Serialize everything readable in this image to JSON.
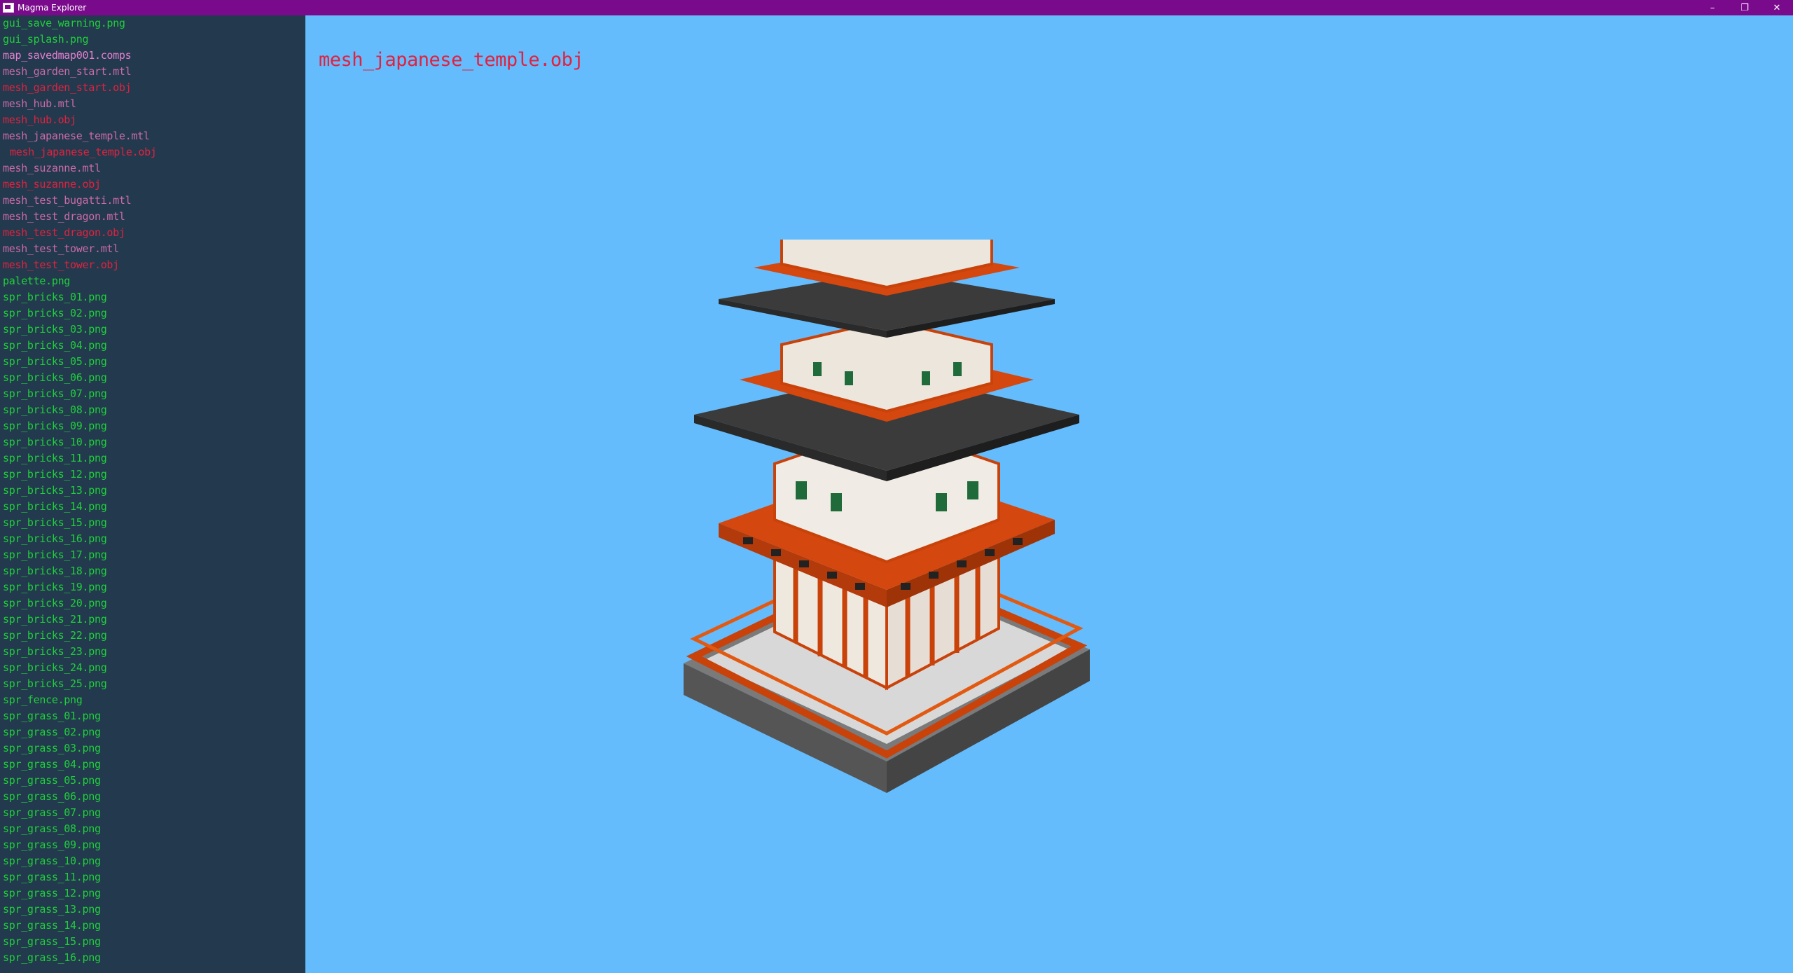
{
  "window": {
    "title": "Magma Explorer",
    "controls": {
      "minimize": "–",
      "maximize": "❐",
      "close": "✕"
    }
  },
  "colors": {
    "title_bar": "#7a0a8c",
    "sidebar_bg": "#233a4e",
    "viewer_bg": "#64bcfd",
    "file_png": "#1fcf3a",
    "file_mtl": "#cc6aa8",
    "file_obj": "#e2213f",
    "file_other": "#e77fd0"
  },
  "files": [
    {
      "name": "gui_save_warning.png",
      "kind": "png"
    },
    {
      "name": "gui_splash.png",
      "kind": "png"
    },
    {
      "name": "map_savedmap001.comps",
      "kind": "other"
    },
    {
      "name": "mesh_garden_start.mtl",
      "kind": "mtl"
    },
    {
      "name": "mesh_garden_start.obj",
      "kind": "obj"
    },
    {
      "name": "mesh_hub.mtl",
      "kind": "mtl"
    },
    {
      "name": "mesh_hub.obj",
      "kind": "obj"
    },
    {
      "name": "mesh_japanese_temple.mtl",
      "kind": "mtl"
    },
    {
      "name": "mesh_japanese_temple.obj",
      "kind": "obj",
      "selected": true
    },
    {
      "name": "mesh_suzanne.mtl",
      "kind": "mtl"
    },
    {
      "name": "mesh_suzanne.obj",
      "kind": "obj"
    },
    {
      "name": "mesh_test_bugatti.mtl",
      "kind": "mtl"
    },
    {
      "name": "mesh_test_dragon.mtl",
      "kind": "mtl"
    },
    {
      "name": "mesh_test_dragon.obj",
      "kind": "obj"
    },
    {
      "name": "mesh_test_tower.mtl",
      "kind": "mtl"
    },
    {
      "name": "mesh_test_tower.obj",
      "kind": "obj"
    },
    {
      "name": "palette.png",
      "kind": "png"
    },
    {
      "name": "spr_bricks_01.png",
      "kind": "png"
    },
    {
      "name": "spr_bricks_02.png",
      "kind": "png"
    },
    {
      "name": "spr_bricks_03.png",
      "kind": "png"
    },
    {
      "name": "spr_bricks_04.png",
      "kind": "png"
    },
    {
      "name": "spr_bricks_05.png",
      "kind": "png"
    },
    {
      "name": "spr_bricks_06.png",
      "kind": "png"
    },
    {
      "name": "spr_bricks_07.png",
      "kind": "png"
    },
    {
      "name": "spr_bricks_08.png",
      "kind": "png"
    },
    {
      "name": "spr_bricks_09.png",
      "kind": "png"
    },
    {
      "name": "spr_bricks_10.png",
      "kind": "png"
    },
    {
      "name": "spr_bricks_11.png",
      "kind": "png"
    },
    {
      "name": "spr_bricks_12.png",
      "kind": "png"
    },
    {
      "name": "spr_bricks_13.png",
      "kind": "png"
    },
    {
      "name": "spr_bricks_14.png",
      "kind": "png"
    },
    {
      "name": "spr_bricks_15.png",
      "kind": "png"
    },
    {
      "name": "spr_bricks_16.png",
      "kind": "png"
    },
    {
      "name": "spr_bricks_17.png",
      "kind": "png"
    },
    {
      "name": "spr_bricks_18.png",
      "kind": "png"
    },
    {
      "name": "spr_bricks_19.png",
      "kind": "png"
    },
    {
      "name": "spr_bricks_20.png",
      "kind": "png"
    },
    {
      "name": "spr_bricks_21.png",
      "kind": "png"
    },
    {
      "name": "spr_bricks_22.png",
      "kind": "png"
    },
    {
      "name": "spr_bricks_23.png",
      "kind": "png"
    },
    {
      "name": "spr_bricks_24.png",
      "kind": "png"
    },
    {
      "name": "spr_bricks_25.png",
      "kind": "png"
    },
    {
      "name": "spr_fence.png",
      "kind": "png"
    },
    {
      "name": "spr_grass_01.png",
      "kind": "png"
    },
    {
      "name": "spr_grass_02.png",
      "kind": "png"
    },
    {
      "name": "spr_grass_03.png",
      "kind": "png"
    },
    {
      "name": "spr_grass_04.png",
      "kind": "png"
    },
    {
      "name": "spr_grass_05.png",
      "kind": "png"
    },
    {
      "name": "spr_grass_06.png",
      "kind": "png"
    },
    {
      "name": "spr_grass_07.png",
      "kind": "png"
    },
    {
      "name": "spr_grass_08.png",
      "kind": "png"
    },
    {
      "name": "spr_grass_09.png",
      "kind": "png"
    },
    {
      "name": "spr_grass_10.png",
      "kind": "png"
    },
    {
      "name": "spr_grass_11.png",
      "kind": "png"
    },
    {
      "name": "spr_grass_12.png",
      "kind": "png"
    },
    {
      "name": "spr_grass_13.png",
      "kind": "png"
    },
    {
      "name": "spr_grass_14.png",
      "kind": "png"
    },
    {
      "name": "spr_grass_15.png",
      "kind": "png"
    },
    {
      "name": "spr_grass_16.png",
      "kind": "png"
    }
  ],
  "viewer": {
    "title": "mesh_japanese_temple.obj",
    "model_icon": "pagoda-model"
  }
}
